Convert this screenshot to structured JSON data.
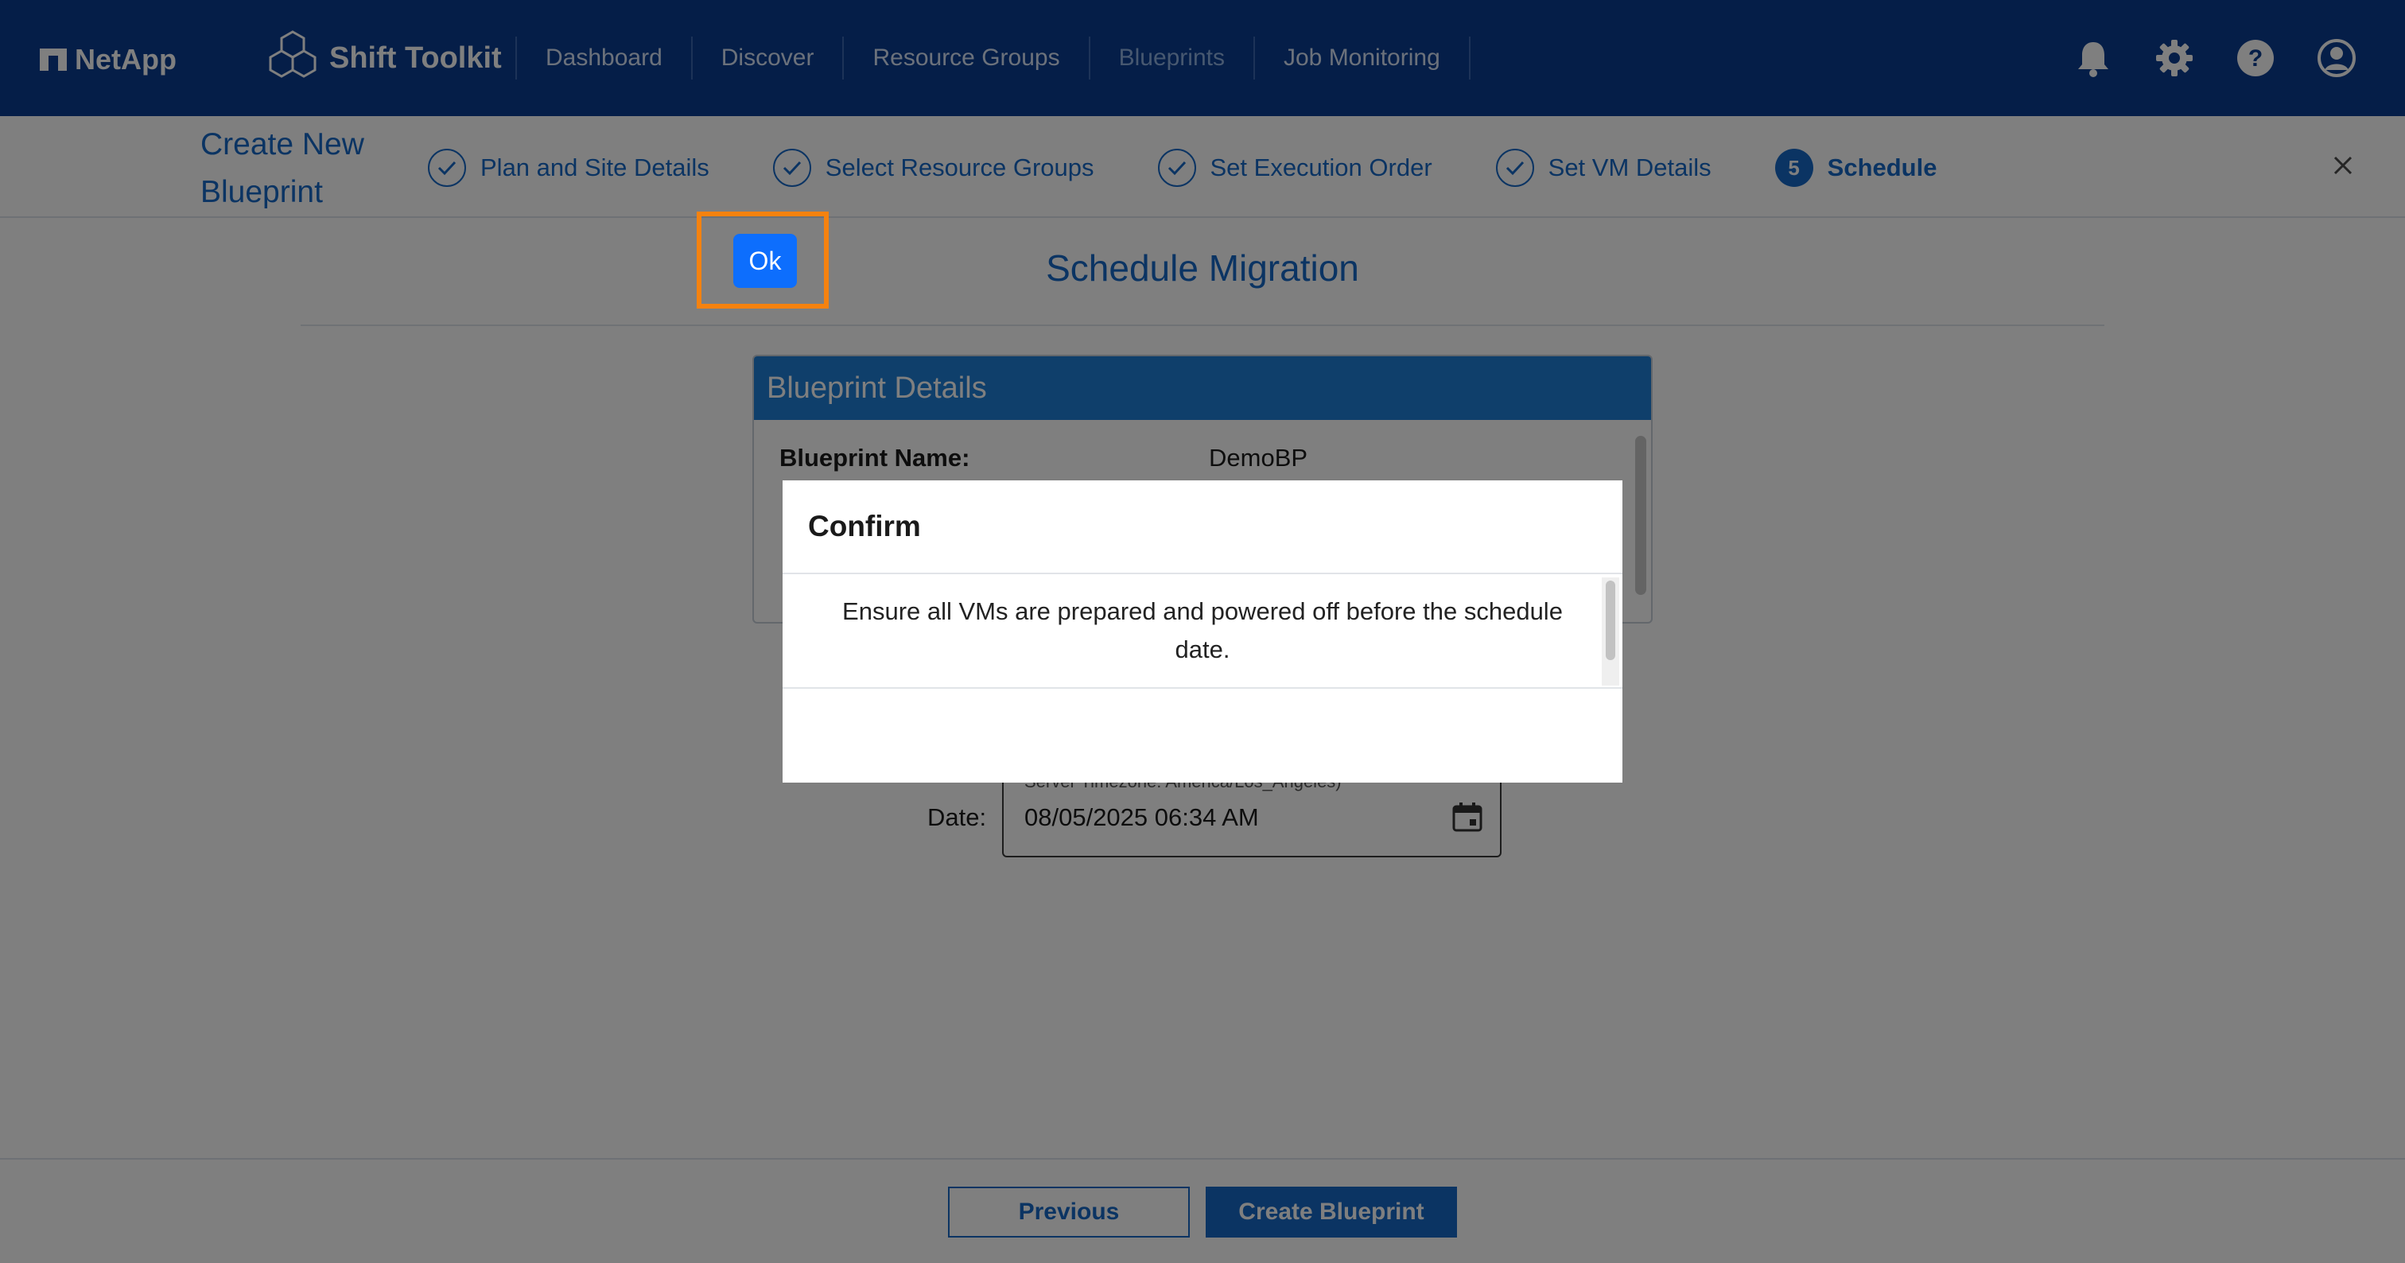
{
  "header": {
    "netapp_brand": "NetApp",
    "product_name": "Shift Toolkit",
    "nav_items": [
      {
        "label": "Dashboard",
        "active": false
      },
      {
        "label": "Discover",
        "active": false
      },
      {
        "label": "Resource Groups",
        "active": false
      },
      {
        "label": "Blueprints",
        "active": true
      },
      {
        "label": "Job Monitoring",
        "active": false
      }
    ],
    "icons": [
      "bell-icon",
      "gear-icon",
      "help-icon",
      "user-account-icon"
    ]
  },
  "wizard": {
    "title": "Create New Blueprint",
    "steps": [
      {
        "label": "Plan and Site Details",
        "status": "completed"
      },
      {
        "label": "Select Resource Groups",
        "status": "completed"
      },
      {
        "label": "Set Execution Order",
        "status": "completed"
      },
      {
        "label": "Set VM Details",
        "status": "completed"
      },
      {
        "label": "Schedule",
        "number": "5",
        "status": "current"
      }
    ],
    "close_icon": "close-icon"
  },
  "main": {
    "title": "Schedule Migration",
    "blueprint_card": {
      "heading": "Blueprint Details",
      "name_label": "Blueprint Name:",
      "name_value": "DemoBP"
    },
    "date_label": "Date:",
    "date_hint": "Server Timezone: America/Los_Angeles)",
    "date_value": "08/05/2025 06:34 AM"
  },
  "footer": {
    "previous_label": "Previous",
    "create_label": "Create Blueprint"
  },
  "modal": {
    "title": "Confirm",
    "message": "Ensure all VMs are prepared and powered off before the schedule date.",
    "ok_label": "Ok"
  },
  "colors": {
    "nav_bg": "#0a3d91",
    "accent": "#1769c7",
    "card_header": "#1f7fd6",
    "ok_button": "#0d6efd",
    "highlight": "#f5820f"
  }
}
